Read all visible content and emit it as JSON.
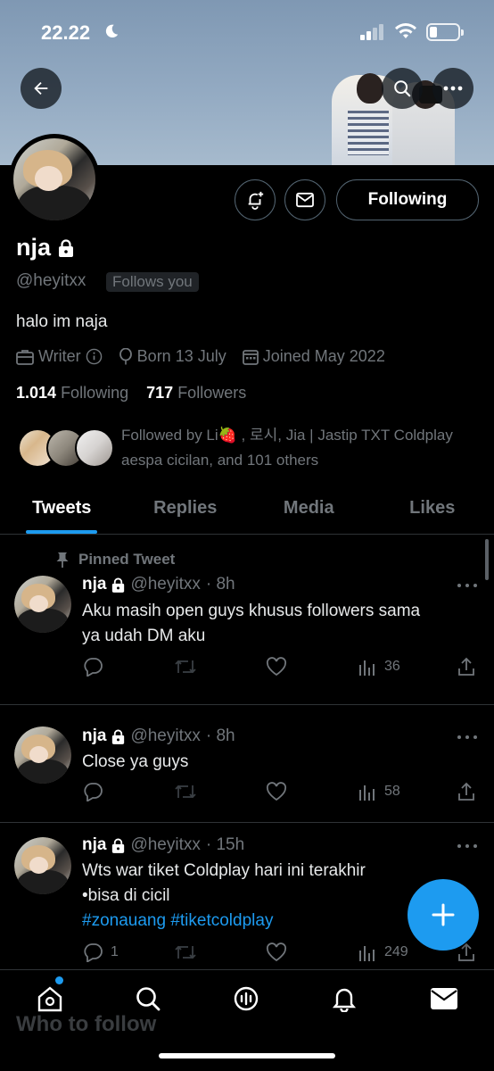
{
  "status_bar": {
    "time": "22.22"
  },
  "profile": {
    "name": "nja",
    "handle": "@heyitxx",
    "follows_you": "Follows you",
    "bio": "halo im naja",
    "category": "Writer",
    "born": "Born 13 July",
    "joined": "Joined May 2022",
    "following_count": "1.014",
    "following_label": "Following",
    "followers_count": "717",
    "followers_label": "Followers",
    "followed_by_line1": "Followed by Li🍓 , 로시, Jia | Jastip TXT Coldplay",
    "followed_by_line2": "aespa cicilan, and 101 others",
    "following_button": "Following"
  },
  "tabs": [
    {
      "label": "Tweets",
      "active": true
    },
    {
      "label": "Replies",
      "active": false
    },
    {
      "label": "Media",
      "active": false
    },
    {
      "label": "Likes",
      "active": false
    }
  ],
  "pinned_label": "Pinned Tweet",
  "tweets": [
    {
      "name": "nja",
      "handle": "@heyitxx",
      "time": "· 8h",
      "line1": "Aku masih open guys khusus followers sama",
      "line2": "ya udah DM aku",
      "replies": "",
      "views": "36"
    },
    {
      "name": "nja",
      "handle": "@heyitxx",
      "time": "· 8h",
      "line1": "Close ya guys",
      "line2": "",
      "replies": "",
      "views": "58"
    },
    {
      "name": "nja",
      "handle": "@heyitxx",
      "time": "· 15h",
      "line1": "Wts war tiket Coldplay hari ini terakhir",
      "line2": "•bisa di cicil",
      "hashtag1": "#zonauang",
      "hashtag2": "#tiketcoldplay",
      "replies": "1",
      "views": "249"
    }
  ],
  "bottom": {
    "who_to_follow": "Who to follow"
  },
  "colors": {
    "accent": "#1d9bf0",
    "background": "#000000",
    "muted": "#71767b"
  }
}
